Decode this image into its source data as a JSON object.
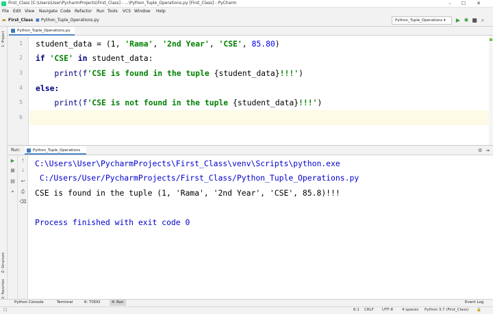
{
  "window": {
    "title": "First_Class [C:\\Users\\User\\PycharmProjects\\First_Class] - ...\\Python_Tuple_Operations.py [First_Class] - PyCharm",
    "min": "–",
    "max": "☐",
    "close": "✕"
  },
  "menu": [
    "File",
    "Edit",
    "View",
    "Navigate",
    "Code",
    "Refactor",
    "Run",
    "Tools",
    "VCS",
    "Window",
    "Help"
  ],
  "breadcrumbs": [
    "First_Class",
    "Python_Tuple_Operations.py"
  ],
  "run_config": "Python_Tuple_Operations",
  "left_stripe": {
    "project": "1: Project",
    "structure": "Z: Structure",
    "favorites": "2: Favorites"
  },
  "editor": {
    "tab": "Python_Tuple_Operations.py",
    "line_numbers": [
      "1",
      "2",
      "3",
      "4",
      "5",
      "6"
    ],
    "lines": [
      [
        {
          "t": "student_data = (1, ",
          "c": "plain"
        },
        {
          "t": "'Rama'",
          "c": "str"
        },
        {
          "t": ", ",
          "c": "plain"
        },
        {
          "t": "'2nd Year'",
          "c": "str"
        },
        {
          "t": ", ",
          "c": "plain"
        },
        {
          "t": "'CSE'",
          "c": "str"
        },
        {
          "t": ", ",
          "c": "plain"
        },
        {
          "t": "85.80",
          "c": "num"
        },
        {
          "t": ")",
          "c": "plain"
        }
      ],
      [
        {
          "t": "if ",
          "c": "kw"
        },
        {
          "t": "'CSE'",
          "c": "str"
        },
        {
          "t": " in ",
          "c": "kw"
        },
        {
          "t": "student_data:",
          "c": "plain"
        }
      ],
      [
        {
          "t": "    print(f",
          "c": "fn"
        },
        {
          "t": "'CSE is found in the tuple ",
          "c": "str"
        },
        {
          "t": "{student_data}",
          "c": "plain"
        },
        {
          "t": "!!!'",
          "c": "str"
        },
        {
          "t": ")",
          "c": "plain"
        }
      ],
      [
        {
          "t": "else:",
          "c": "kw"
        }
      ],
      [
        {
          "t": "    print(f",
          "c": "fn"
        },
        {
          "t": "'CSE is not found in the tuple ",
          "c": "str"
        },
        {
          "t": "{student_data}",
          "c": "plain"
        },
        {
          "t": "!!!'",
          "c": "str"
        },
        {
          "t": ")",
          "c": "plain"
        }
      ],
      [
        {
          "t": "",
          "c": "plain"
        }
      ]
    ]
  },
  "run_panel": {
    "label": "Run:",
    "tab": "Python_Tuple_Operations",
    "output": [
      {
        "t": "C:\\Users\\User\\PycharmProjects\\First_Class\\venv\\Scripts\\python.exe",
        "c": "path"
      },
      {
        "t": " C:/Users/User/PycharmProjects/First_Class/Python_Tuple_Operations.py",
        "c": "path"
      },
      {
        "t": "CSE is found in the tuple (1, 'Rama', '2nd Year', 'CSE', 85.8)!!!",
        "c": "plain"
      },
      {
        "t": "",
        "c": "plain"
      },
      {
        "t": "Process finished with exit code 0",
        "c": "proc"
      }
    ]
  },
  "bottom_tabs": [
    "Python Console",
    "Terminal",
    "6: TODO",
    "4: Run"
  ],
  "event_log": "Event Log",
  "status": {
    "position": "6:1",
    "line_sep": "CRLF",
    "encoding": "UTF-8",
    "indent": "4 spaces",
    "interpreter": "Python 3.7 (First_Class)"
  }
}
